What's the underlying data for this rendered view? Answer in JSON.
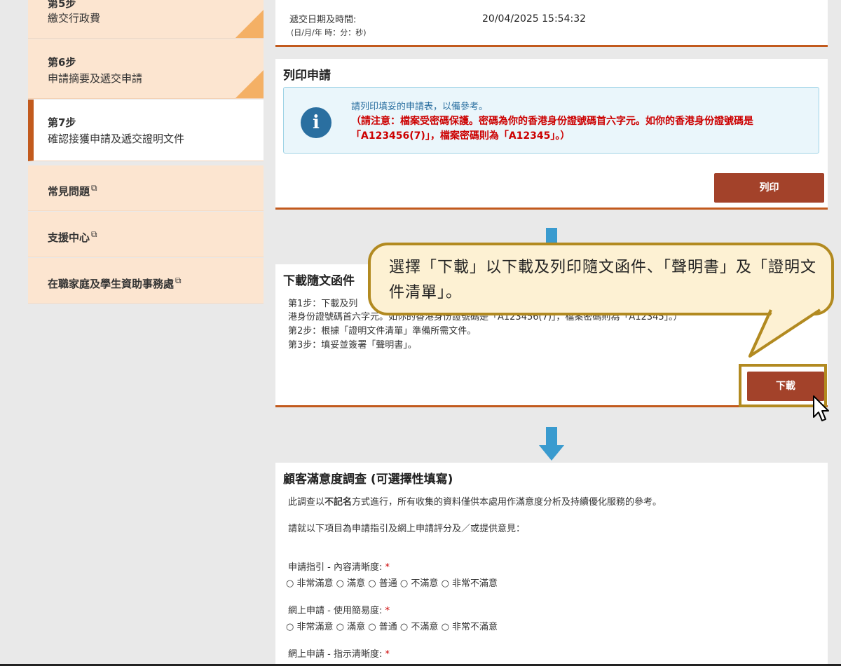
{
  "sidebar": {
    "steps": [
      {
        "number": "第5步",
        "label": "繳交行政費",
        "completed": true
      },
      {
        "number": "第6步",
        "label": "申請摘要及遞交申請",
        "completed": true
      },
      {
        "number": "第7步",
        "label": "確認接獲申請及遞交證明文件",
        "completed": false,
        "active": true
      }
    ],
    "links": [
      {
        "label": "常見問題",
        "icon": "external-link-icon"
      },
      {
        "label": "支援中心",
        "icon": "external-link-icon"
      },
      {
        "label": "在職家庭及學生資助事務處",
        "icon": "external-link-icon"
      }
    ]
  },
  "submission": {
    "label": "遞交日期及時間:",
    "format": "(日/月/年 時：分：秒)",
    "value": "20/04/2025 15:54:32"
  },
  "print_section": {
    "title": "列印申請",
    "info_line1": "請列印填妥的申請表，以備參考。",
    "info_warning": "（請注意：檔案受密碼保護。密碼為你的香港身份證號碼首六字元。如你的香港身份證號碼是「A123456(7)」，檔案密碼則為「A12345」。）",
    "button": "列印"
  },
  "download_section": {
    "title": "下載隨文函件",
    "step1a": "第1步：下載及列",
    "step1b": "港身份證號碼首六字元。如你的香港身份證號碼是「A123456(7)」，檔案密碼則為「A12345」。）",
    "step2": "第2步：根據「證明文件清單」準備所需文件。",
    "step3": "第3步：填妥並簽署「聲明書」。",
    "button": "下載"
  },
  "callout": {
    "text": "選擇「下載」以下載及列印隨文函件、「聲明書」及「證明文件清單」。"
  },
  "survey": {
    "title": "顧客滿意度調查 (可選擇性填寫)",
    "intro_pre": "此調查以",
    "intro_bold": "不記名",
    "intro_post": "方式進行，所有收集的資料僅供本處用作滿意度分析及持續優化服務的參考。",
    "instruction": "請就以下項目為申請指引及網上申請評分及／或提供意見：",
    "questions": [
      {
        "label": "申請指引 - 內容清晰度:",
        "required": "*"
      },
      {
        "label": "網上申請 - 使用簡易度:",
        "required": "*"
      },
      {
        "label": "網上申請 - 指示清晰度:",
        "required": "*"
      }
    ],
    "options": [
      "非常滿意",
      "滿意",
      "普通",
      "不滿意",
      "非常不滿意"
    ]
  },
  "colors": {
    "accent": "#c25a1d",
    "button": "#a3422a",
    "sidebar_bg": "#fce5d0",
    "callout_border": "#b28a20",
    "callout_bg": "#fdf1d3",
    "arrow": "#3a9bcf",
    "warning": "#cc0000"
  }
}
